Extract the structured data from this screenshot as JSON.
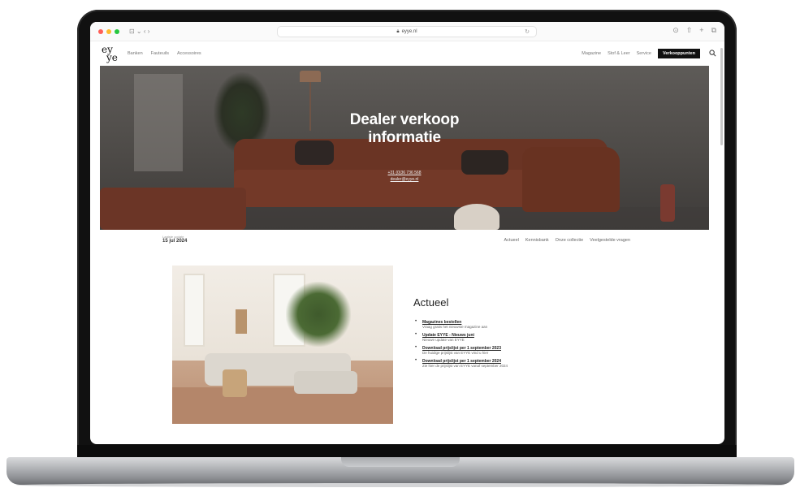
{
  "browser": {
    "url": "eyye.nl",
    "nav_controls": "⊡ ⌄  ‹  ›"
  },
  "site": {
    "logo_top": "ey",
    "logo_bottom": "ye",
    "nav_left": [
      "Banken",
      "Fauteuils",
      "Accessoires"
    ],
    "nav_right": [
      "Magazine",
      "Stof & Leer",
      "Service"
    ],
    "dealer_button": "Verkooppunten"
  },
  "hero": {
    "title_line1": "Dealer verkoop",
    "title_line2": "informatie",
    "phone": "+31 (0)36 736 568",
    "email": "dealer@eyye.nl"
  },
  "subbar": {
    "date_label": "Laatste update",
    "date_value": "15 jul 2024",
    "links": [
      "Actueel",
      "Kennisbank",
      "Onze collectie",
      "Veelgestelde vragen"
    ]
  },
  "actueel": {
    "title": "Actueel",
    "items": [
      {
        "link": "Magazines bestellen",
        "desc": "Vraag gratis het nieuwste magazine aan"
      },
      {
        "link": "Update EYYE - Nieuws juni",
        "desc": "Nieuwe update van EYYE"
      },
      {
        "link": "Download prijslijst per 1 september 2023",
        "desc": "De huidige prijslijst van EYYE vind u hier"
      },
      {
        "link": "Download prijslijst per 1 september 2024",
        "desc": "Zie hier de prijslijst van EYYE vanaf september 2024"
      }
    ]
  }
}
